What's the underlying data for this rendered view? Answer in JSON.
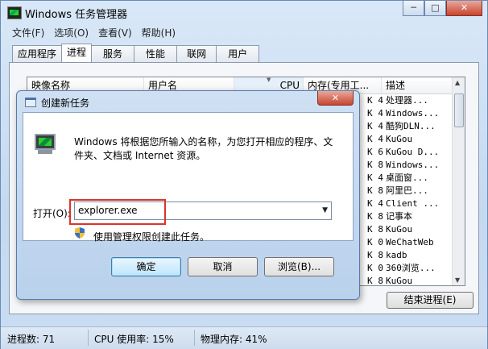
{
  "window": {
    "title": "Windows 任务管理器",
    "minimize": "─",
    "maximize": "□",
    "close": "✕"
  },
  "menu": [
    "文件(F)",
    "选项(O)",
    "查看(V)",
    "帮助(H)"
  ],
  "tabs": [
    "应用程序",
    "进程",
    "服务",
    "性能",
    "联网",
    "用户"
  ],
  "active_tab": "进程",
  "table": {
    "columns": [
      "映像名称",
      "用户名",
      "CPU",
      "内存(专用工...",
      "描述"
    ],
    "rows": [
      {
        "mem": "4",
        "desc": "处理器..."
      },
      {
        "mem": "4",
        "desc": "Windows..."
      },
      {
        "mem": "4",
        "desc": "酷狗DLN..."
      },
      {
        "mem": "4",
        "desc": "KuGou"
      },
      {
        "mem": "6",
        "desc": "KuGou D..."
      },
      {
        "mem": "8",
        "desc": "Windows..."
      },
      {
        "mem": "4",
        "desc": "桌面窗..."
      },
      {
        "mem": "8",
        "desc": "阿里巴..."
      },
      {
        "mem": "4",
        "desc": "Client ..."
      },
      {
        "mem": "8",
        "desc": "记事本"
      },
      {
        "mem": "8",
        "desc": "KuGou"
      },
      {
        "mem": "0",
        "desc": "WeChatWeb"
      },
      {
        "mem": "8",
        "desc": "kadb"
      },
      {
        "mem": "0",
        "desc": "360浏览..."
      },
      {
        "mem": "8",
        "desc": "KuGou"
      }
    ],
    "unit": "K"
  },
  "end_process_button": "结束进程(E)",
  "status": {
    "processes": "进程数: 71",
    "cpu": "CPU 使用率: 15%",
    "memory": "物理内存: 41%"
  },
  "dialog": {
    "title": "创建新任务",
    "close": "✕",
    "description": "Windows 将根据您所输入的名称，为您打开相应的程序、文件夹、文档或 Internet 资源。",
    "open_label": "打开(O):",
    "input_value": "explorer.exe",
    "admin_text": "使用管理权限创建此任务。",
    "ok": "确定",
    "cancel": "取消",
    "browse": "浏览(B)..."
  }
}
